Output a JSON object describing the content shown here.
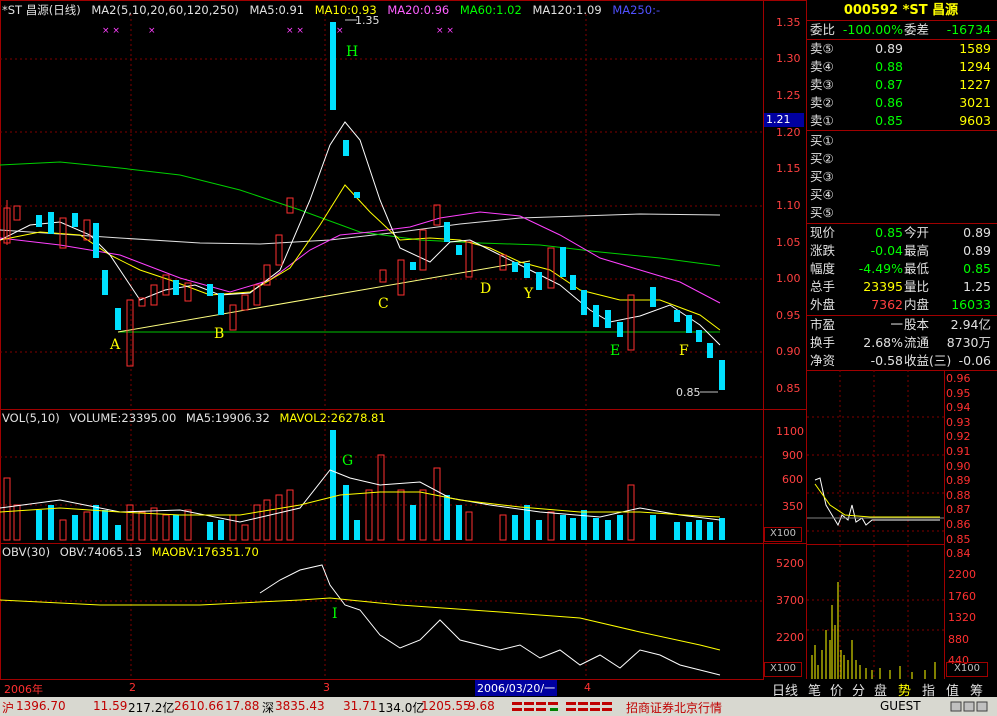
{
  "header": {
    "title": "*ST 昌源(日线)",
    "ma_label": "MA2(5,10,20,60,120,250)",
    "ma5": "MA5:0.91",
    "ma10": "MA10:0.93",
    "ma20": "MA20:0.96",
    "ma60": "MA60:1.02",
    "ma120": "MA120:1.09",
    "ma250": "MA250:-"
  },
  "price_axis": [
    "1.35",
    "1.30",
    "1.25",
    "1.20",
    "1.15",
    "1.10",
    "1.05",
    "1.00",
    "0.95",
    "0.90",
    "0.85"
  ],
  "price_marker": "1.21",
  "annotations": {
    "high_label": "1.35",
    "low_label": "0.85",
    "points": [
      "A",
      "B",
      "C",
      "D",
      "Y",
      "E",
      "F",
      "H",
      "G",
      "I"
    ]
  },
  "volume": {
    "header": "VOL(5,10)",
    "volume": "VOLUME:23395.00",
    "ma5": "MA5:19906.32",
    "mavol2": "MAVOL2:26278.81",
    "axis": [
      "1100",
      "900",
      "600",
      "350"
    ],
    "unit": "X100"
  },
  "obv": {
    "header": "OBV(30)",
    "obv": "OBV:74065.13",
    "maobv": "MAOBV:176351.70",
    "axis": [
      "5200",
      "3700",
      "2200"
    ],
    "unit": "X100"
  },
  "date_axis": {
    "year": "2006年",
    "m2": "2",
    "m3": "3",
    "cursor_date": "2006/03/20/一",
    "m4": "4"
  },
  "quote": {
    "code_name": "000592 *ST 昌源",
    "weibi_label": "委比",
    "weibi": "-100.00%",
    "weicha_label": "委差",
    "weicha": "-16734",
    "sells": [
      {
        "label": "卖⑤",
        "price": "0.89",
        "vol": "1589"
      },
      {
        "label": "卖④",
        "price": "0.88",
        "vol": "1294"
      },
      {
        "label": "卖③",
        "price": "0.87",
        "vol": "1227"
      },
      {
        "label": "卖②",
        "price": "0.86",
        "vol": "3021"
      },
      {
        "label": "卖①",
        "price": "0.85",
        "vol": "9603"
      }
    ],
    "buys": [
      "买①",
      "买②",
      "买③",
      "买④",
      "买⑤"
    ],
    "stats": [
      {
        "l1": "现价",
        "v1": "0.85",
        "l2": "今开",
        "v2": "0.89"
      },
      {
        "l1": "涨跌",
        "v1": "-0.04",
        "l2": "最高",
        "v2": "0.89"
      },
      {
        "l1": "幅度",
        "v1": "-4.49%",
        "l2": "最低",
        "v2": "0.85"
      },
      {
        "l1": "总手",
        "v1": "23395",
        "l2": "量比",
        "v2": "1.25"
      },
      {
        "l1": "外盘",
        "v1": "7362",
        "l2": "内盘",
        "v2": "16033"
      }
    ],
    "fin": [
      {
        "l1": "市盈",
        "v1": "一",
        "l2": "股本",
        "v2": "2.94亿"
      },
      {
        "l1": "换手",
        "v1": "2.68%",
        "l2": "流通",
        "v2": "8730万"
      },
      {
        "l1": "净资",
        "v1": "-0.58",
        "l2": "收益(三)",
        "v2": "-0.06"
      }
    ]
  },
  "intraday": {
    "price_axis": [
      "0.96",
      "0.95",
      "0.94",
      "0.93",
      "0.92",
      "0.91",
      "0.90",
      "0.89",
      "0.88",
      "0.87",
      "0.86",
      "0.85",
      "0.84"
    ],
    "vol_axis": [
      "2200",
      "1760",
      "1320",
      "880",
      "440"
    ],
    "unit": "X100"
  },
  "bottom_tabs": [
    "日线",
    "笔",
    "价",
    "分",
    "盘",
    "势",
    "指",
    "值",
    "筹"
  ],
  "statusbar": {
    "sh_label": "沪",
    "sh_index": "1396.70",
    "sh_change": "11.59",
    "sh_amount": "217.2亿",
    "sz_a": "2610.66",
    "sz_b": "17.88",
    "sz_label": "深",
    "sz_index": "3835.43",
    "sz_change": "31.71",
    "sz_amount": "134.0亿",
    "sz_c": "1205.55",
    "sz_d": "9.68",
    "broker": "招商证券北京行情",
    "user": "GUEST"
  },
  "colors": {
    "up": "#ff3030",
    "down": "#00ffff",
    "grid": "#800000",
    "ma5": "#ffffff",
    "ma10": "#ffff00",
    "ma20": "#ff60ff",
    "ma60": "#00ff00",
    "ma120": "#e0e0e0"
  }
}
